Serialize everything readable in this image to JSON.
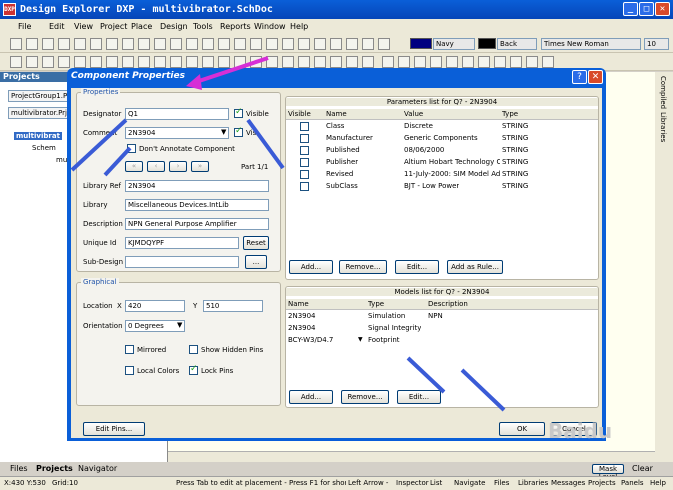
{
  "app": {
    "title": "Design Explorer DXP - multivibrator.SchDoc",
    "logo": "DXP"
  },
  "menu": [
    "File",
    "Edit",
    "View",
    "Project",
    "Place",
    "Design",
    "Tools",
    "Reports",
    "Window",
    "Help"
  ],
  "toolbar": {
    "color1": "Navy",
    "color2": "Back",
    "font": "Times New Roman",
    "size": "10"
  },
  "left": {
    "title": "Projects",
    "project_group": "ProjectGroup1.PrjGrp",
    "project_file": "multivibrator.PrjPCB",
    "tree": [
      "multivibrat",
      "Schem",
      "mult"
    ],
    "tabs": [
      "Files",
      "Projects",
      "Navigator"
    ]
  },
  "right_tabs": [
    "Compiled",
    "Libraries"
  ],
  "dialog": {
    "title": "Component Properties",
    "properties": {
      "group": "Properties",
      "designator_label": "Designator",
      "designator": "Q1",
      "visible_label": "Visible",
      "comment_label": "Comment",
      "comment": "2N3904",
      "visible2_label": "Vis",
      "dont_annotate": "Don't Annotate Component",
      "part": "Part 1/1",
      "libref_label": "Library Ref",
      "libref": "2N3904",
      "library_label": "Library",
      "library": "Miscellaneous Devices.IntLib",
      "description_label": "Description",
      "description": "NPN General Purpose Amplifier",
      "uniqueid_label": "Unique Id",
      "uniqueid": "KJMDQYPF",
      "reset": "Reset",
      "subdesign_label": "Sub-Design",
      "subdesign_btn": "..."
    },
    "graphical": {
      "group": "Graphical",
      "location_label": "Location",
      "x_label": "X",
      "x": "420",
      "y_label": "Y",
      "y": "510",
      "orientation_label": "Orientation",
      "orientation": "0 Degrees",
      "mirrored": "Mirrored",
      "show_hidden": "Show Hidden Pins",
      "local_colors": "Local Colors",
      "lock_pins": "Lock Pins"
    },
    "params": {
      "title": "Parameters list for Q? - 2N3904",
      "cols": [
        "Visible",
        "Name",
        "Value",
        "Type"
      ],
      "rows": [
        [
          "Class",
          "Discrete",
          "STRING"
        ],
        [
          "Manufacturer",
          "Generic Components",
          "STRING"
        ],
        [
          "Published",
          "08/06/2000",
          "STRING"
        ],
        [
          "Publisher",
          "Altium Hobart Technology Cen",
          "STRING"
        ],
        [
          "Revised",
          "11-July-2000: SIM Model Adde",
          "STRING"
        ],
        [
          "SubClass",
          "BJT - Low Power",
          "STRING"
        ]
      ],
      "buttons": [
        "Add...",
        "Remove...",
        "Edit...",
        "Add as Rule..."
      ]
    },
    "models": {
      "title": "Models list for Q? - 2N3904",
      "cols": [
        "Name",
        "Type",
        "Description"
      ],
      "rows": [
        [
          "2N3904",
          "Simulation",
          "NPN"
        ],
        [
          "2N3904",
          "Signal Integrity",
          ""
        ],
        [
          "BCY-W3/D4.7",
          "Footprint",
          ""
        ]
      ],
      "buttons": [
        "Add...",
        "Remove...",
        "Edit..."
      ]
    },
    "edit_pins": "Edit Pins...",
    "ok": "OK",
    "cancel": "Cancel"
  },
  "status": {
    "coords": "X:430 Y:530",
    "grid": "Grid:10",
    "message": "Press Tab to edit at placement - Press F1 for shortcuts",
    "left_arrow": "Left Arrow - Mo",
    "tabs": [
      "Inspector",
      "List",
      "Navigate",
      "Files",
      "Libraries",
      "Messages",
      "Projects",
      "Panels",
      "Help"
    ]
  },
  "sheet_btns": {
    "mask": "Mask Level",
    "clear": "Clear"
  },
  "watermark": "Baidu"
}
